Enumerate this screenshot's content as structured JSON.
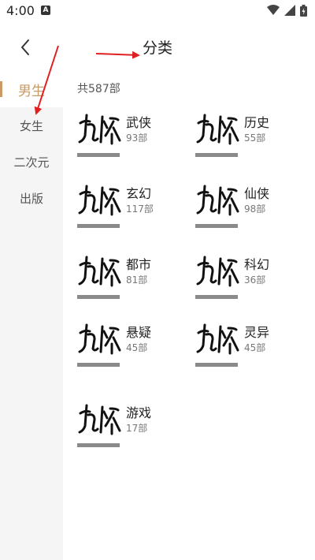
{
  "status_bar": {
    "time": "4:00",
    "notification_icon_letter": "A",
    "icons": [
      "wifi-icon",
      "signal-icon",
      "battery-charging-icon"
    ]
  },
  "header": {
    "back_icon": "chevron-left-icon",
    "title": "分类"
  },
  "sidebar": {
    "items": [
      {
        "label": "男生",
        "active": true
      },
      {
        "label": "女生",
        "active": false
      },
      {
        "label": "二次元",
        "active": false
      },
      {
        "label": "出版",
        "active": false
      }
    ],
    "accent_color": "#c79a66"
  },
  "main": {
    "total": "共587部",
    "categories": [
      {
        "name": "武侠",
        "count": "93部"
      },
      {
        "name": "历史",
        "count": "55部"
      },
      {
        "name": "玄幻",
        "count": "117部"
      },
      {
        "name": "仙侠",
        "count": "98部"
      },
      {
        "name": "都市",
        "count": "81部"
      },
      {
        "name": "科幻",
        "count": "36部"
      },
      {
        "name": "悬疑",
        "count": "45部"
      },
      {
        "name": "灵异",
        "count": "45部"
      },
      {
        "name": "游戏",
        "count": "17部"
      }
    ]
  },
  "annotations": {
    "arrow_color": "#e02020"
  }
}
